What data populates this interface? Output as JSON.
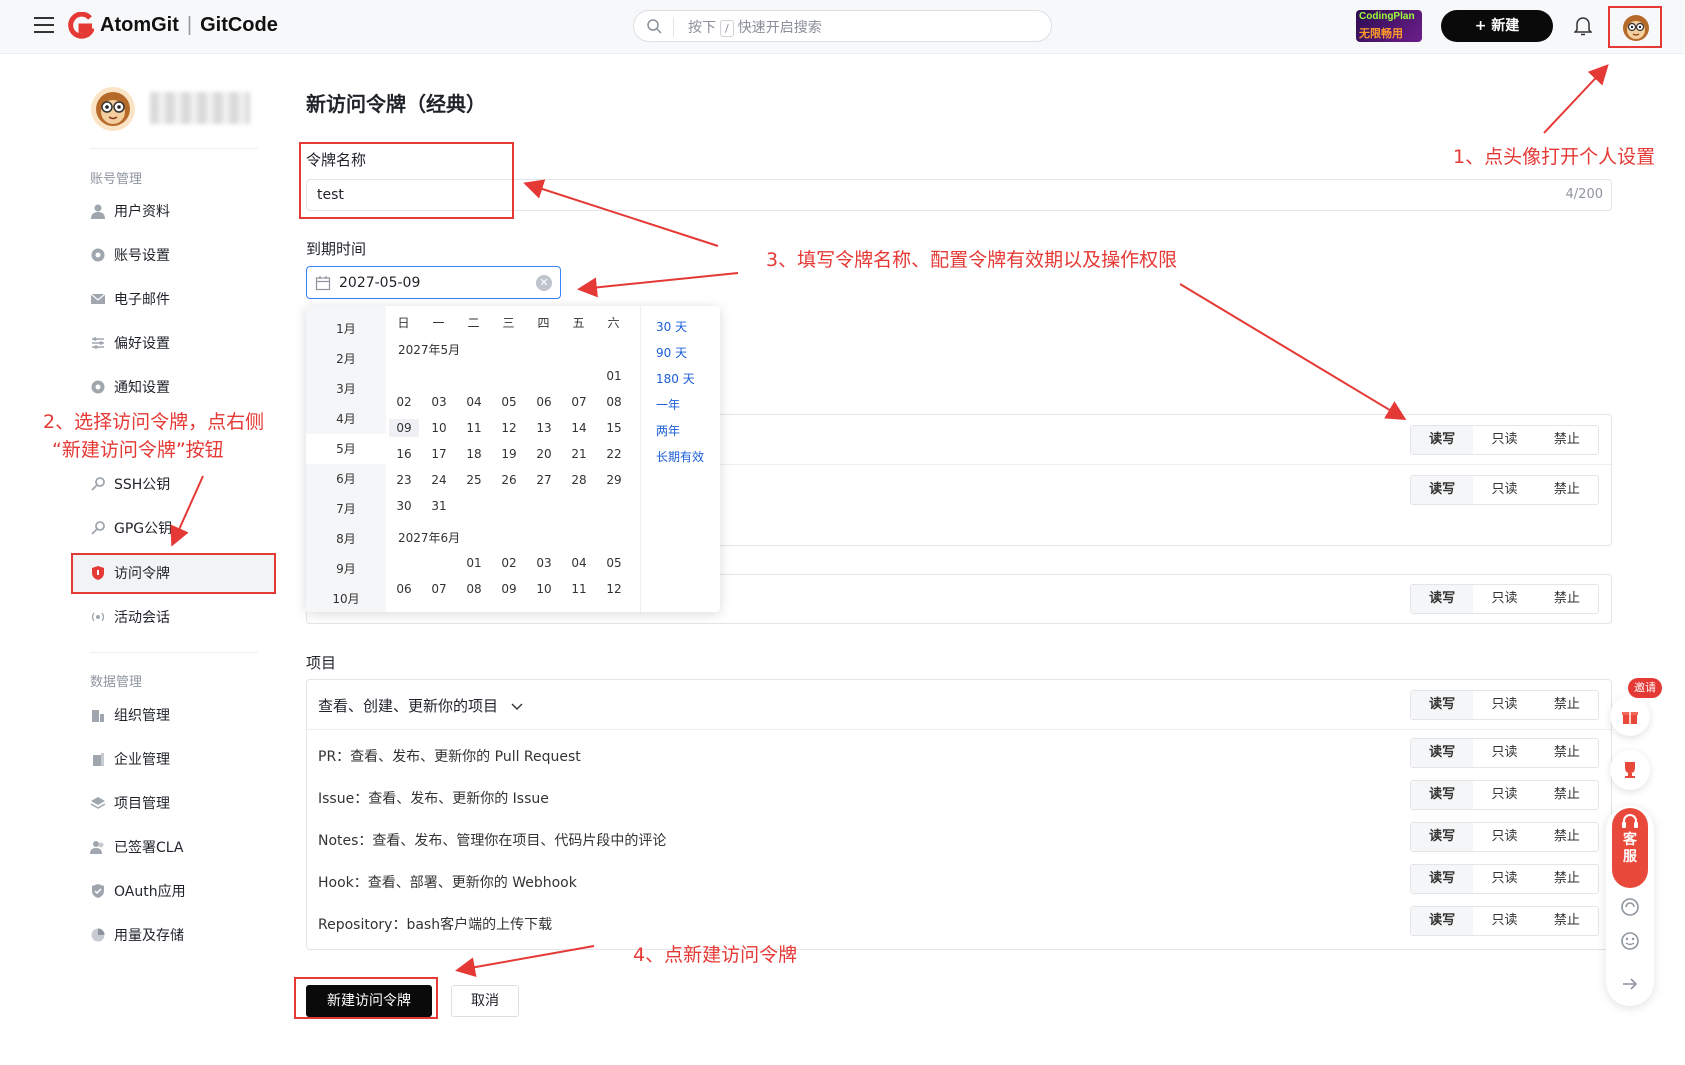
{
  "header": {
    "brand_left": "AtomGit",
    "brand_right": "GitCode",
    "search_prefix": "按下",
    "search_key": "/",
    "search_hint": "快速开启搜索",
    "promo_line1": "CodingPlan",
    "promo_line2": "无限畅用",
    "new_label": "+ 新建"
  },
  "sidebar": {
    "group_account": "账号管理",
    "account_items": [
      {
        "label": "用户资料"
      },
      {
        "label": "账号设置"
      },
      {
        "label": "电子邮件"
      },
      {
        "label": "偏好设置"
      },
      {
        "label": "通知设置"
      },
      {
        "label": "SSH公钥"
      },
      {
        "label": "GPG公钥"
      },
      {
        "label": "访问令牌"
      },
      {
        "label": "活动会话"
      }
    ],
    "group_data": "数据管理",
    "data_items": [
      {
        "label": "组织管理"
      },
      {
        "label": "企业管理"
      },
      {
        "label": "项目管理"
      },
      {
        "label": "已签署CLA"
      },
      {
        "label": "OAuth应用"
      },
      {
        "label": "用量及存储"
      }
    ]
  },
  "main": {
    "title": "新访问令牌（经典）",
    "token_name_label": "令牌名称",
    "token_name_value": "test",
    "token_name_count": "4/200",
    "expiry_label": "到期时间",
    "expiry_value": "2027-05-09",
    "project_section": "项目",
    "project_header": "查看、创建、更新你的项目",
    "project_rows": [
      {
        "text": "PR：查看、发布、更新你的 Pull Request"
      },
      {
        "text": "Issue：查看、发布、更新你的 Issue"
      },
      {
        "text": "Notes：查看、发布、管理你在项目、代码片段中的评论"
      },
      {
        "text": "Hook：查看、部署、更新你的 Webhook"
      },
      {
        "text": "Repository：bash客户端的上传下载"
      }
    ],
    "seg": {
      "rw": "读写",
      "ro": "只读",
      "deny": "禁止"
    },
    "create_button": "新建访问令牌",
    "cancel_button": "取消"
  },
  "calendar": {
    "months": [
      "1月",
      "2月",
      "3月",
      "4月",
      "5月",
      "6月",
      "7月",
      "8月",
      "9月",
      "10月"
    ],
    "weekdays": [
      "日",
      "一",
      "二",
      "三",
      "四",
      "五",
      "六"
    ],
    "month_label_1": "2027年5月",
    "month_label_2": "2027年6月",
    "may_days": [
      "01",
      "02",
      "03",
      "04",
      "05",
      "06",
      "07",
      "08",
      "09",
      "10",
      "11",
      "12",
      "13",
      "14",
      "15",
      "16",
      "17",
      "18",
      "19",
      "20",
      "21",
      "22",
      "23",
      "24",
      "25",
      "26",
      "27",
      "28",
      "29",
      "30",
      "31"
    ],
    "june_days": [
      "01",
      "02",
      "03",
      "04",
      "05",
      "06",
      "07",
      "08",
      "09",
      "10",
      "11",
      "12"
    ],
    "quick": [
      "30 天",
      "90 天",
      "180 天",
      "一年",
      "两年",
      "长期有效"
    ]
  },
  "annotations": {
    "a1": "1、点头像打开个人设置",
    "a2_line1": "2、选择访问令牌，点右侧",
    "a2_line2": "“新建访问令牌”按钮",
    "a3": "3、填写令牌名称、配置令牌有效期以及操作权限",
    "a4": "4、点新建访问令牌"
  },
  "floating": {
    "invite": "邀请",
    "service": "客服"
  },
  "colors": {
    "annotation": "#e53935",
    "primary_button": "#0a0a0a",
    "link": "#1a5ed8"
  }
}
